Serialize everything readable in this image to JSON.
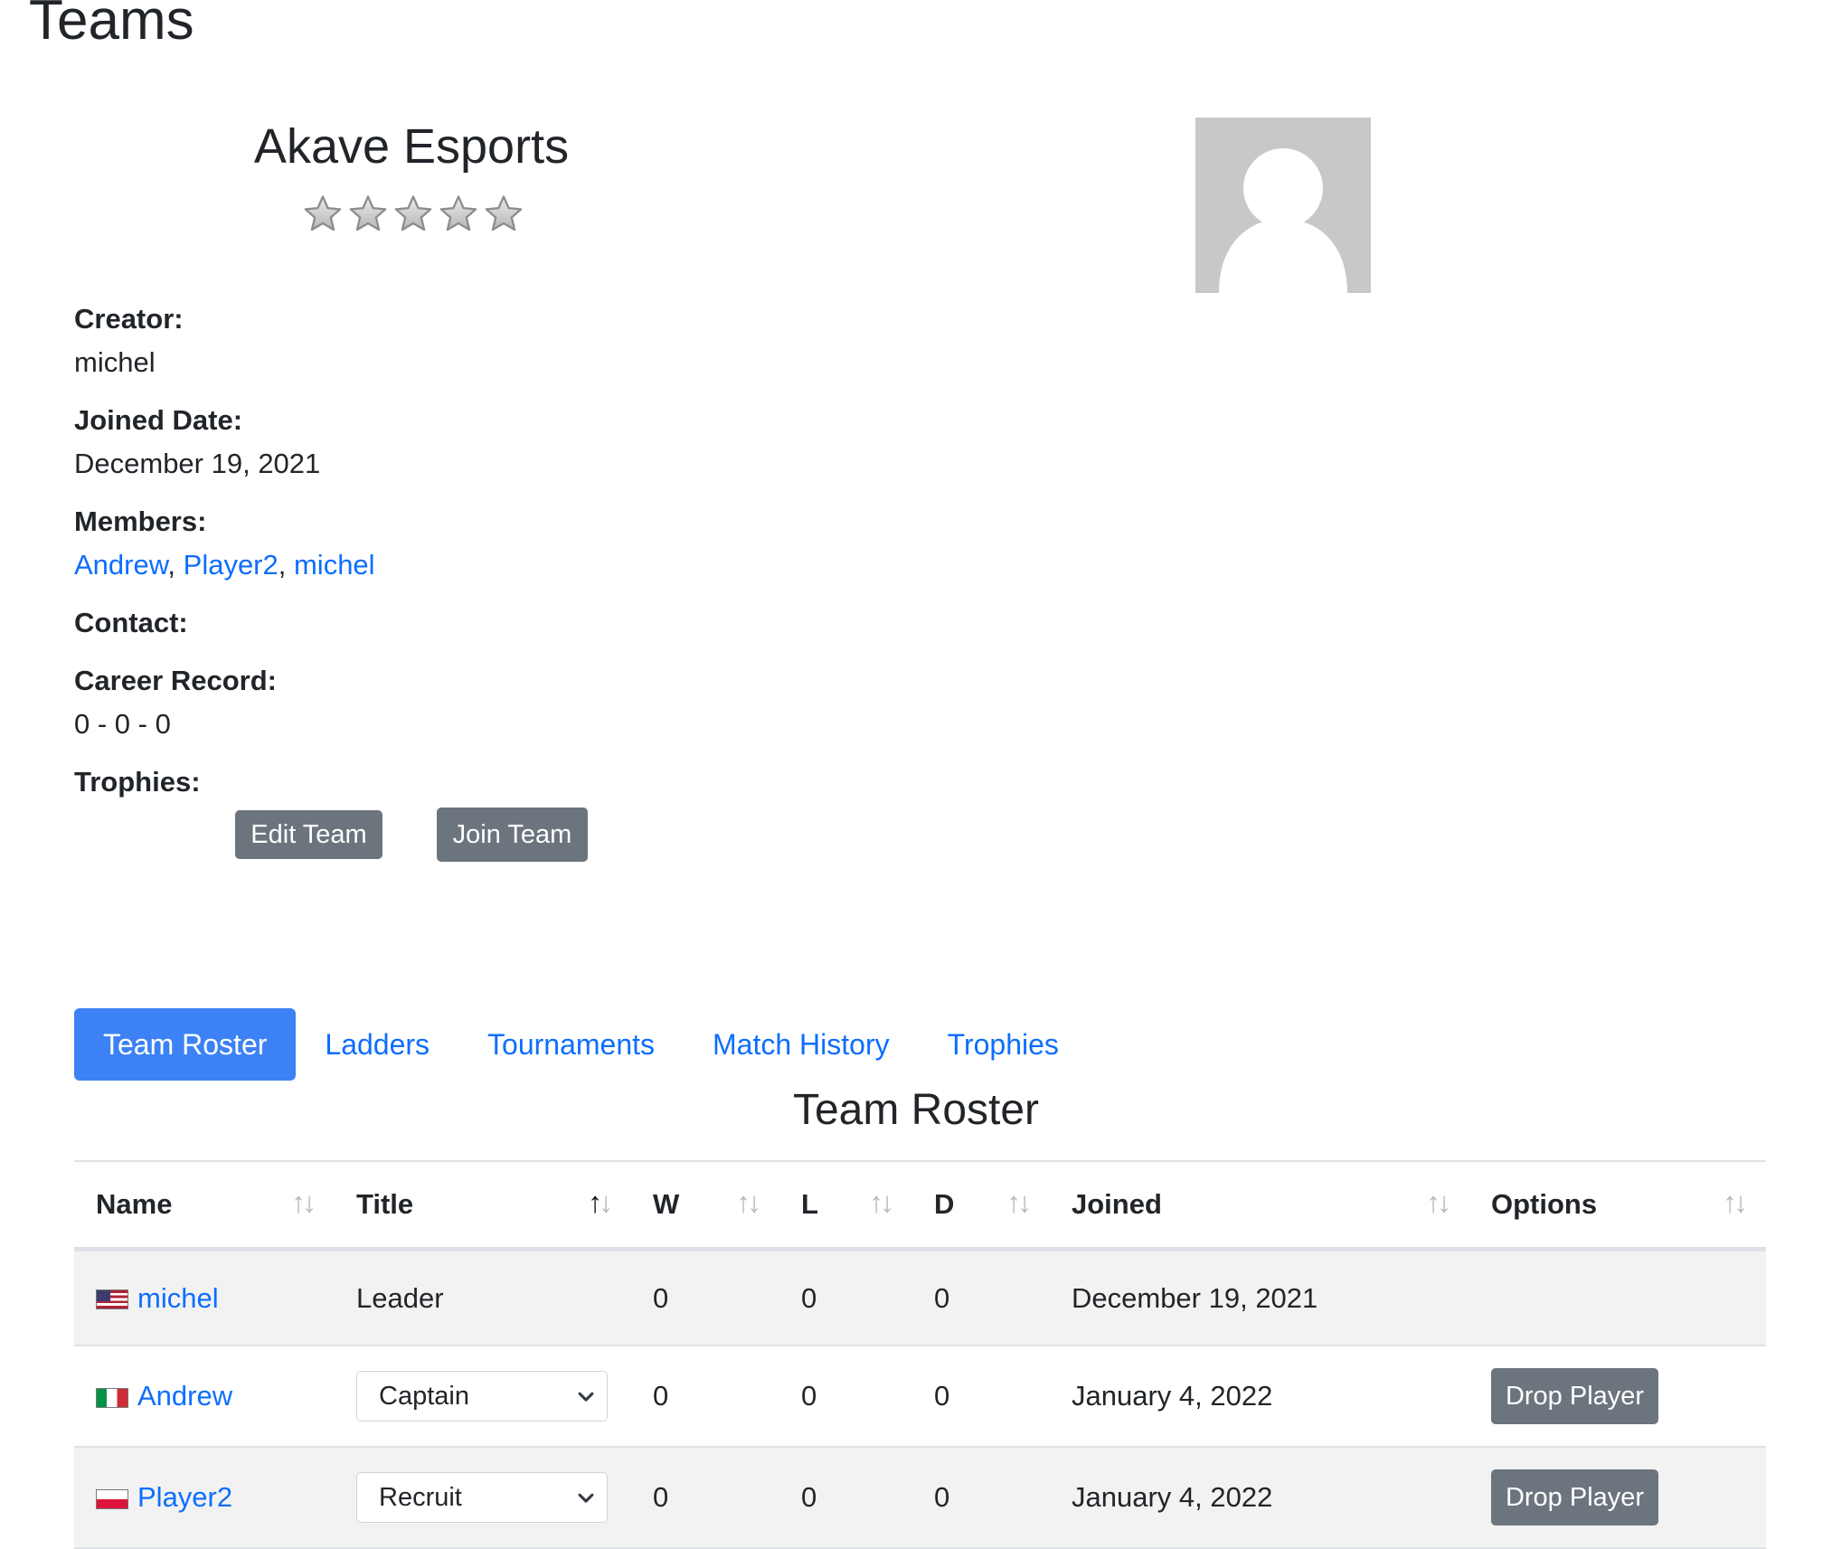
{
  "page": {
    "title": "Teams"
  },
  "team": {
    "name": "Akave Esports",
    "rating": 0,
    "rating_max": 5,
    "creator_label": "Creator:",
    "creator": "michel",
    "joined_label": "Joined Date:",
    "joined": "December 19, 2021",
    "members_label": "Members:",
    "members": [
      "Andrew",
      "Player2",
      "michel"
    ],
    "contact_label": "Contact:",
    "contact": "",
    "record_label": "Career Record:",
    "record": "0 - 0 - 0",
    "trophies_label": "Trophies:"
  },
  "actions": {
    "edit": "Edit Team",
    "join": "Join Team"
  },
  "tabs": [
    {
      "label": "Team Roster",
      "active": true
    },
    {
      "label": "Ladders",
      "active": false
    },
    {
      "label": "Tournaments",
      "active": false
    },
    {
      "label": "Match History",
      "active": false
    },
    {
      "label": "Trophies",
      "active": false
    }
  ],
  "roster": {
    "title": "Team Roster",
    "columns": [
      "Name",
      "Title",
      "W",
      "L",
      "D",
      "Joined",
      "Options"
    ],
    "sorted_column": "Title",
    "rows": [
      {
        "flag": "us-flag-icon",
        "name": "michel",
        "title": "Leader",
        "title_editable": false,
        "w": "0",
        "l": "0",
        "d": "0",
        "joined": "December 19, 2021",
        "option": ""
      },
      {
        "flag": "italy-flag-icon",
        "name": "Andrew",
        "title": "Captain",
        "title_editable": true,
        "w": "0",
        "l": "0",
        "d": "0",
        "joined": "January 4, 2022",
        "option": "Drop Player"
      },
      {
        "flag": "poland-flag-icon",
        "name": "Player2",
        "title": "Recruit",
        "title_editable": true,
        "w": "0",
        "l": "0",
        "d": "0",
        "joined": "January 4, 2022",
        "option": "Drop Player"
      }
    ]
  },
  "colors": {
    "accent": "#3c82f6",
    "link": "#0d6efd",
    "button": "#6c757d",
    "row_stripe": "#f2f2f2"
  }
}
